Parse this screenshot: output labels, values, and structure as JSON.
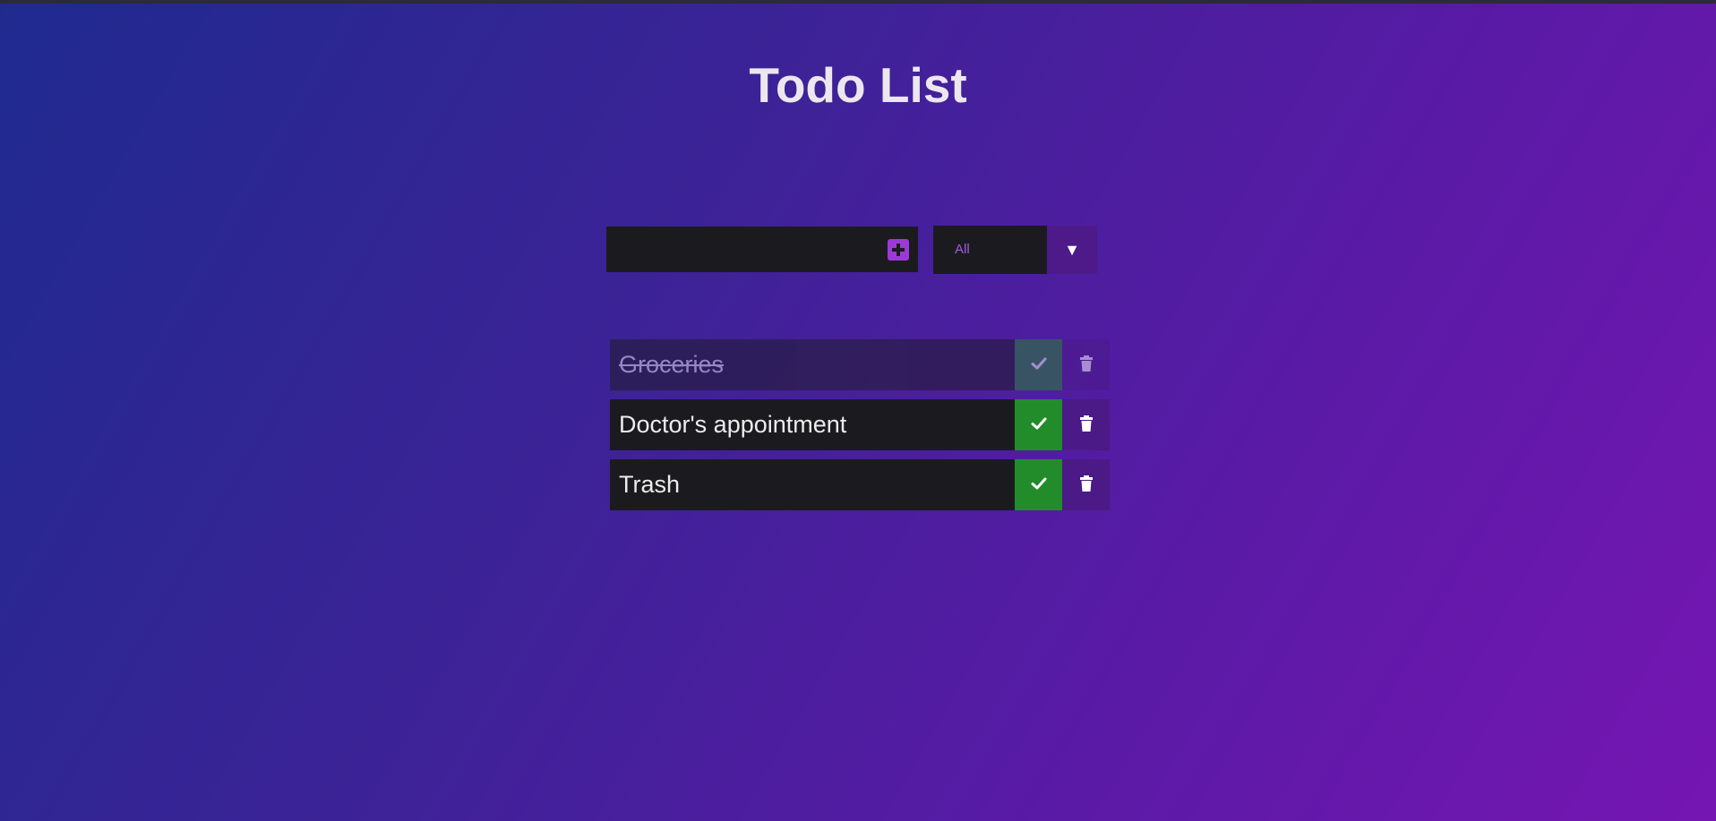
{
  "header": {
    "title": "Todo List"
  },
  "form": {
    "input_value": "",
    "input_placeholder": "",
    "add_icon": "plus-square-icon",
    "filter_selected": "All",
    "filter_arrow": "▼"
  },
  "todos": [
    {
      "text": "Groceries",
      "completed": true
    },
    {
      "text": "Doctor's appointment",
      "completed": false
    },
    {
      "text": "Trash",
      "completed": false
    }
  ],
  "colors": {
    "accent": "#9b3ad6",
    "complete": "#238c2a",
    "trash": "#4b1a86",
    "item_bg": "#1b1b1f"
  }
}
